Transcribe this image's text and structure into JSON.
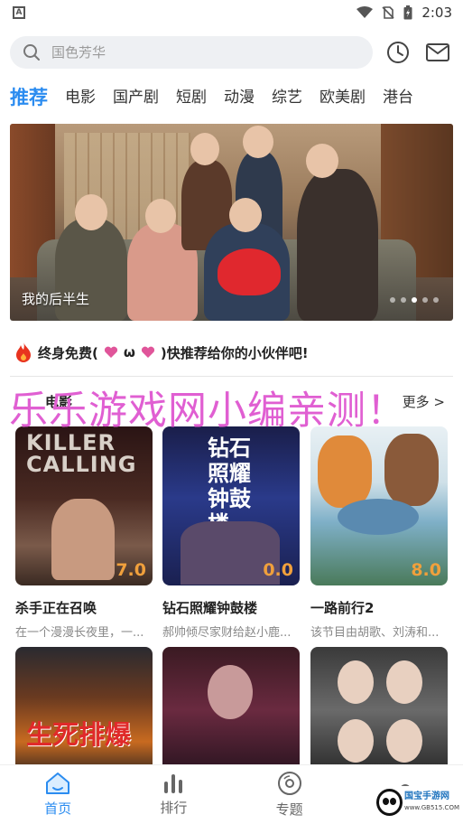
{
  "status_bar": {
    "time": "2:03"
  },
  "search": {
    "placeholder": "国色芳华"
  },
  "tabs": [
    "推荐",
    "电影",
    "国产剧",
    "短剧",
    "动漫",
    "综艺",
    "欧美剧",
    "港台"
  ],
  "banner": {
    "caption": "我的后半生",
    "page_count": 5,
    "active_page": 2
  },
  "promo": {
    "text_a": "终身免费(",
    "text_b": "ω",
    "text_c": ")快推荐给你的小伙伴吧!"
  },
  "section": {
    "title": "电影",
    "more": "更多 >"
  },
  "watermark": "乐乐游戏网小编亲测！",
  "cards": [
    {
      "title": "杀手正在召唤",
      "desc": "在一个漫漫长夜里，一...",
      "score": "7.0",
      "poster_text": "KILLER CALLING"
    },
    {
      "title": "钻石照耀钟鼓楼",
      "desc": "郝帅倾尽家财给赵小鹿...",
      "score": "0.0",
      "poster_text": "钻石照耀钟鼓楼"
    },
    {
      "title": "一路前行2",
      "desc": "该节目由胡歌、刘涛和...",
      "score": "8.0",
      "poster_text": ""
    }
  ],
  "row2_posters": [
    {
      "poster_text": "生死排爆"
    },
    {
      "poster_text": ""
    },
    {
      "poster_text": ""
    }
  ],
  "bottom_nav": [
    {
      "label": "首页",
      "icon": "home-icon"
    },
    {
      "label": "排行",
      "icon": "bar-chart-icon"
    },
    {
      "label": "专题",
      "icon": "disc-icon"
    },
    {
      "label": "",
      "icon": "profile-icon"
    }
  ],
  "corner_logo": {
    "line1": "国宝手游网",
    "line2": "www.GB515.COM"
  },
  "colors": {
    "accent": "#2b8cf0",
    "watermark": "#e05fd2",
    "score": "#f0a03c"
  }
}
